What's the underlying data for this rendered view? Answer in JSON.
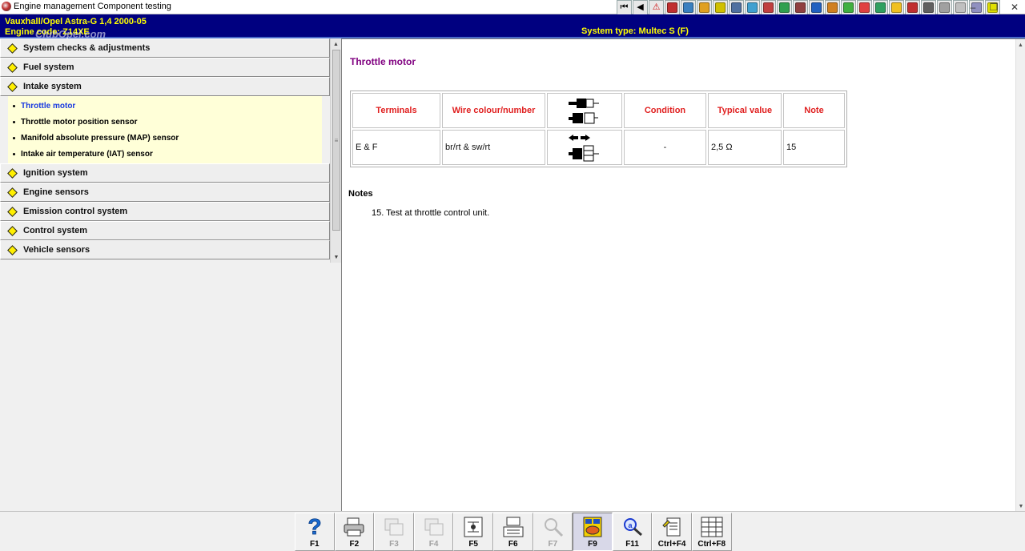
{
  "window": {
    "title": "Engine management Component testing",
    "controls": {
      "minimize": "–",
      "restore": "❐",
      "close": "✕"
    }
  },
  "toolbar": {
    "buttons": [
      {
        "icon": "first-page-icon",
        "glyph": "⏮",
        "color": "#f0f0f0"
      },
      {
        "icon": "back-icon",
        "glyph": "◀",
        "color": "#f0f0f0"
      },
      {
        "icon": "warning-icon",
        "glyph": "⚠",
        "color": "#ffdede"
      },
      {
        "icon": "tool-icon",
        "glyph": "",
        "color": "#c03030"
      },
      {
        "icon": "diagram-icon",
        "glyph": "",
        "color": "#3a80c0"
      },
      {
        "icon": "engine-icon",
        "glyph": "",
        "color": "#e0a020"
      },
      {
        "icon": "gear-icon",
        "glyph": "",
        "color": "#d0c000"
      },
      {
        "icon": "wheel-icon",
        "glyph": "",
        "color": "#5070a0"
      },
      {
        "icon": "measure-icon",
        "glyph": "",
        "color": "#40a0d0"
      },
      {
        "icon": "lift-icon",
        "glyph": "",
        "color": "#c04040"
      },
      {
        "icon": "oil-icon",
        "glyph": "",
        "color": "#30a050"
      },
      {
        "icon": "brake-icon",
        "glyph": "",
        "color": "#904040"
      },
      {
        "icon": "aircon-icon",
        "glyph": "",
        "color": "#2060c0"
      },
      {
        "icon": "electric-icon",
        "glyph": "",
        "color": "#d08020"
      },
      {
        "icon": "battery-icon",
        "glyph": "",
        "color": "#40b040"
      },
      {
        "icon": "lamp-icon",
        "glyph": "",
        "color": "#e04040"
      },
      {
        "icon": "wiring-icon",
        "glyph": "",
        "color": "#30a060"
      },
      {
        "icon": "sensor-icon",
        "glyph": "",
        "color": "#f0c020"
      },
      {
        "icon": "car-icon",
        "glyph": "",
        "color": "#c03030"
      },
      {
        "icon": "info-icon",
        "glyph": "",
        "color": "#606060"
      },
      {
        "icon": "service-icon",
        "glyph": "",
        "color": "#a0a0a0"
      },
      {
        "icon": "hazard-icon",
        "glyph": "",
        "color": "#c0c0c0"
      },
      {
        "icon": "key-icon",
        "glyph": "",
        "color": "#9090c0"
      },
      {
        "icon": "notes-icon",
        "glyph": "",
        "color": "#e0e000"
      }
    ]
  },
  "header": {
    "vehicle": "Vauxhall/Opel  Astra-G  1,4  2000-05",
    "engine": "Engine code: Z14XE",
    "watermark": "ClubOpel.com",
    "system_type": "System type: Multec S (F)"
  },
  "menu": {
    "categories": [
      {
        "label": "System checks & adjustments",
        "open": false
      },
      {
        "label": "Fuel system",
        "open": false
      },
      {
        "label": "Intake system",
        "open": true,
        "items": [
          {
            "label": "Throttle motor",
            "active": true
          },
          {
            "label": "Throttle motor position sensor",
            "active": false
          },
          {
            "label": "Manifold absolute pressure (MAP) sensor",
            "active": false
          },
          {
            "label": "Intake air temperature (IAT) sensor",
            "active": false
          }
        ]
      },
      {
        "label": "Ignition system",
        "open": false
      },
      {
        "label": "Engine sensors",
        "open": false
      },
      {
        "label": "Emission control system",
        "open": false
      },
      {
        "label": "Control system",
        "open": false
      },
      {
        "label": "Vehicle sensors",
        "open": false
      }
    ]
  },
  "content": {
    "title": "Throttle motor",
    "table": {
      "headers": {
        "terminals": "Terminals",
        "wire": "Wire colour/number",
        "connector": "",
        "condition": "Condition",
        "typical": "Typical value",
        "note": "Note"
      },
      "rows": [
        {
          "terminals": "E & F",
          "wire": "br/rt & sw/rt",
          "condition": "-",
          "typical": "2,5 Ω",
          "note": "15"
        }
      ]
    },
    "notes_heading": "Notes",
    "notes": [
      "15. Test at throttle control unit."
    ]
  },
  "function_keys": [
    {
      "key": "F1",
      "icon": "help-icon",
      "enabled": true
    },
    {
      "key": "F2",
      "icon": "print-icon",
      "enabled": true
    },
    {
      "key": "F3",
      "icon": "document-icon",
      "enabled": false
    },
    {
      "key": "F4",
      "icon": "document-icon",
      "enabled": false
    },
    {
      "key": "F5",
      "icon": "schematic-icon",
      "enabled": true
    },
    {
      "key": "F6",
      "icon": "ecu-icon",
      "enabled": true
    },
    {
      "key": "F7",
      "icon": "probe-icon",
      "enabled": false
    },
    {
      "key": "F9",
      "icon": "component-location-icon",
      "enabled": true,
      "pressed": true
    },
    {
      "key": "F11",
      "icon": "search-icon",
      "enabled": true
    },
    {
      "key": "Ctrl+F4",
      "icon": "notes-icon",
      "enabled": true
    },
    {
      "key": "Ctrl+F8",
      "icon": "data-table-icon",
      "enabled": true
    }
  ]
}
